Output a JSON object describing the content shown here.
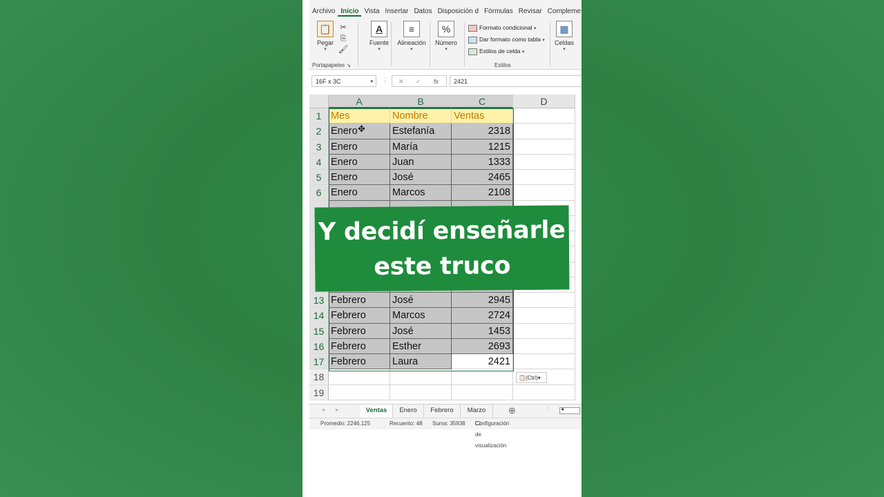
{
  "ribbon": {
    "tabs": [
      "Archivo",
      "Inicio",
      "Vista",
      "Insertar",
      "Datos",
      "Disposición d",
      "Fórmulas",
      "Revisar",
      "Compleme"
    ],
    "active_tab": "Inicio",
    "clipboard": {
      "paste_label": "Pegar",
      "group_label": "Portapapeles"
    },
    "font_label": "Fuente",
    "alignment_label": "Alineación",
    "number_label": "Número",
    "styles": {
      "conditional": "Formato condicional",
      "as_table": "Dar formato como tabla",
      "cell_styles": "Estilos de celda",
      "group_label": "Estilos"
    },
    "cells_label": "Celdas"
  },
  "formula_bar": {
    "name_box": "16F x 3C",
    "fx": "fx",
    "value": "2421"
  },
  "sheet": {
    "columns": [
      "A",
      "B",
      "C",
      "D"
    ],
    "header_row": {
      "num": "1",
      "cells": [
        "Mes",
        "Nombre",
        "Ventas"
      ]
    },
    "rows": [
      {
        "num": "2",
        "mes": "Enero",
        "nombre": "Estefanía",
        "ventas": "2318"
      },
      {
        "num": "3",
        "mes": "Enero",
        "nombre": "María",
        "ventas": "1215"
      },
      {
        "num": "4",
        "mes": "Enero",
        "nombre": "Juan",
        "ventas": "1333"
      },
      {
        "num": "5",
        "mes": "Enero",
        "nombre": "José",
        "ventas": "2465"
      },
      {
        "num": "6",
        "mes": "Enero",
        "nombre": "Marcos",
        "ventas": "2108"
      },
      {
        "num": "13",
        "mes": "Febrero",
        "nombre": "José",
        "ventas": "2945"
      },
      {
        "num": "14",
        "mes": "Febrero",
        "nombre": "Marcos",
        "ventas": "2724"
      },
      {
        "num": "15",
        "mes": "Febrero",
        "nombre": "José",
        "ventas": "1453"
      },
      {
        "num": "16",
        "mes": "Febrero",
        "nombre": "Esther",
        "ventas": "2693"
      },
      {
        "num": "17",
        "mes": "Febrero",
        "nombre": "Laura",
        "ventas": "2421"
      }
    ],
    "empty_rows": [
      "18",
      "19"
    ],
    "paste_options": "(Ctrl)"
  },
  "sheet_tabs": [
    "Ventas",
    "Enero",
    "Febrero",
    "Marzo"
  ],
  "active_sheet": "Ventas",
  "status_bar": {
    "average": "Promedio: 2246.125",
    "count": "Recuento: 48",
    "sum": "Suma: 35938",
    "display_settings": "Configuración de visualización"
  },
  "overlay_caption": {
    "line1": "Y decidí enseñarle",
    "line2": "este truco"
  },
  "colors": {
    "background": "#2e8043",
    "banner": "#1e8c3c",
    "excel_green": "#217346",
    "header_fill": "#fff2a8",
    "header_text": "#c07a00"
  }
}
